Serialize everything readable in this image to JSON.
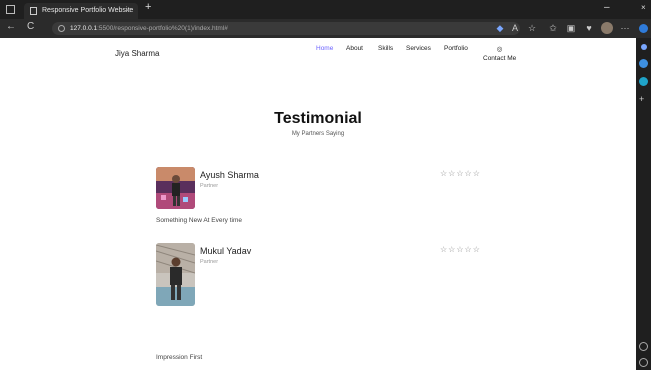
{
  "browser": {
    "tab_title": "Responsive Portfolio Website",
    "tab_close": "×",
    "new_tab": "+",
    "url_host": "127.0.0.1",
    "url_rest": ":5500/responsive-portfolio%20(1)/index.html#",
    "minimize": "–",
    "close": "×",
    "back": "←",
    "reload": "C",
    "more": "···"
  },
  "page": {
    "brand": "Jiya Sharma",
    "nav": [
      {
        "label": "Home"
      },
      {
        "label": "About"
      },
      {
        "label": "Skills"
      },
      {
        "label": "Services"
      },
      {
        "label": "Portfolio"
      },
      {
        "label": "Contact Me",
        "icon": "contact-icon"
      }
    ],
    "contact_icon": "◎",
    "section_title": "Testimonial",
    "section_subtitle": "My Partners Saying",
    "testimonials": [
      {
        "name": "Ayush Sharma",
        "role": "Partner",
        "rating_stars": "☆☆☆☆☆",
        "rating": 0,
        "quote": "Something New At Every time"
      },
      {
        "name": "Mukul Yadav",
        "role": "Partner",
        "rating_stars": "☆☆☆☆☆",
        "rating": 0,
        "quote": "Impression First"
      }
    ]
  },
  "colors": {
    "accent": "#6c63ff",
    "chrome_dark": "#1f1f1f",
    "edge_blue": "#2f7bd9"
  }
}
